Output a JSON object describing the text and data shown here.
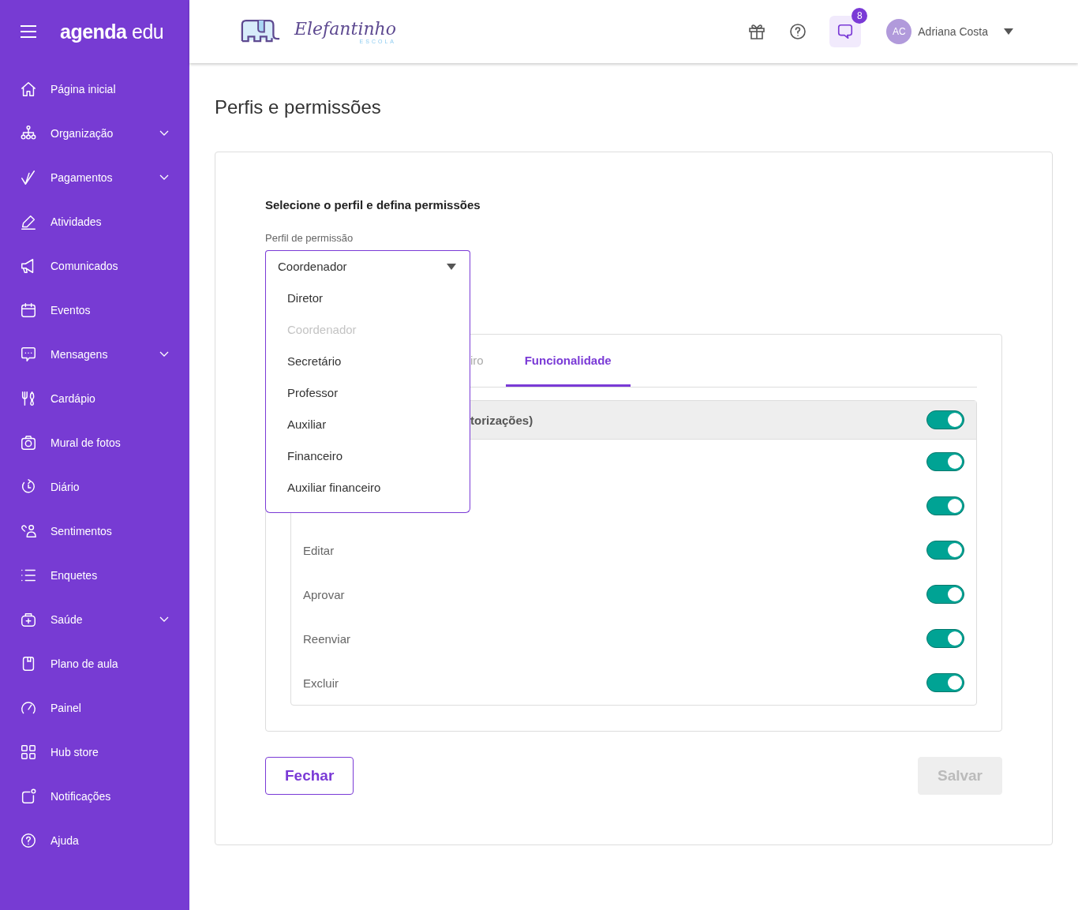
{
  "sidebar": {
    "logo": "**agenda** edu",
    "items": [
      {
        "label": "Página inicial",
        "expandable": false
      },
      {
        "label": "Organização",
        "expandable": true
      },
      {
        "label": "Pagamentos",
        "expandable": true
      },
      {
        "label": "Atividades",
        "expandable": false
      },
      {
        "label": "Comunicados",
        "expandable": false
      },
      {
        "label": "Eventos",
        "expandable": false
      },
      {
        "label": "Mensagens",
        "expandable": true
      },
      {
        "label": "Cardápio",
        "expandable": false
      },
      {
        "label": "Mural de fotos",
        "expandable": false
      },
      {
        "label": "Diário",
        "expandable": false
      },
      {
        "label": "Sentimentos",
        "expandable": false
      },
      {
        "label": "Enquetes",
        "expandable": false
      },
      {
        "label": "Saúde",
        "expandable": true
      },
      {
        "label": "Plano de aula",
        "expandable": false
      },
      {
        "label": "Painel",
        "expandable": false
      },
      {
        "label": "Hub store",
        "expandable": false
      },
      {
        "label": "Notificações",
        "expandable": false
      },
      {
        "label": "Ajuda",
        "expandable": false
      }
    ]
  },
  "header": {
    "school_name": "Elefantinho",
    "school_subtitle": "ESCOLA",
    "messages_badge": "8",
    "user": {
      "initials": "AC",
      "name": "Adriana Costa"
    }
  },
  "page": {
    "title": "Perfis e permissões",
    "heading": "Selecione o perfil e defina permissões",
    "profile_select": {
      "label": "Perfil de permissão",
      "value": "Coordenador",
      "options": [
        {
          "label": "Diretor",
          "selected": false
        },
        {
          "label": "Coordenador",
          "selected": true
        },
        {
          "label": "Secretário",
          "selected": false
        },
        {
          "label": "Professor",
          "selected": false
        },
        {
          "label": "Auxiliar",
          "selected": false
        },
        {
          "label": "Financeiro",
          "selected": false
        },
        {
          "label": "Auxiliar financeiro",
          "selected": false
        }
      ]
    },
    "tabs": [
      {
        "label": "iro",
        "selected": false
      },
      {
        "label": "Funcionalidade",
        "selected": true
      }
    ],
    "section": {
      "title": "torizações)",
      "on": true
    },
    "rows": [
      {
        "on": true
      },
      {
        "on": true
      },
      {
        "label": "Editar",
        "on": true
      },
      {
        "label": "Aprovar",
        "on": true
      },
      {
        "label": "Reenviar",
        "on": true
      },
      {
        "label": "Excluir",
        "on": true
      }
    ],
    "buttons": [
      {
        "label": "Fechar",
        "kind": "outline",
        "disabled": false
      },
      {
        "label": "Salvar",
        "kind": "primary",
        "disabled": true
      }
    ]
  }
}
